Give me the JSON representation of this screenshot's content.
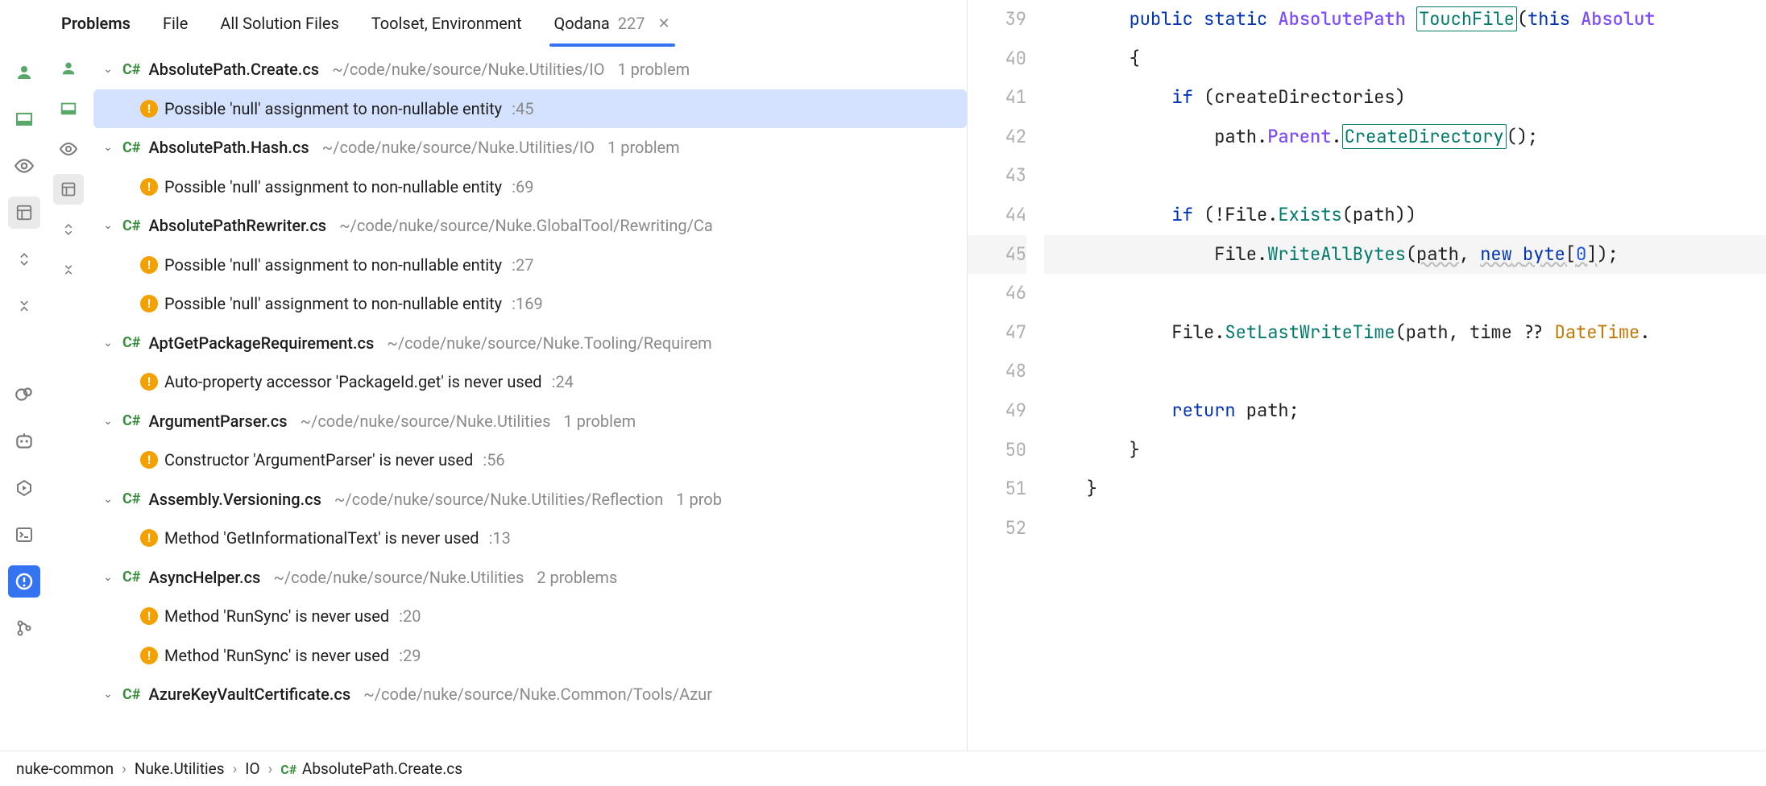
{
  "tabs": {
    "problems": "Problems",
    "file": "File",
    "allSolution": "All Solution Files",
    "toolset": "Toolset, Environment",
    "qodana": "Qodana",
    "qodana_count": "227"
  },
  "tree": [
    {
      "kind": "file",
      "name": "AbsolutePath.Create.cs",
      "path": "~/code/nuke/source/Nuke.Utilities/IO",
      "count": "1 problem",
      "selected": false
    },
    {
      "kind": "issue",
      "text": "Possible 'null' assignment to non-nullable entity",
      "loc": ":45",
      "selected": true
    },
    {
      "kind": "file",
      "name": "AbsolutePath.Hash.cs",
      "path": "~/code/nuke/source/Nuke.Utilities/IO",
      "count": "1 problem"
    },
    {
      "kind": "issue",
      "text": "Possible 'null' assignment to non-nullable entity",
      "loc": ":69"
    },
    {
      "kind": "file",
      "name": "AbsolutePathRewriter.cs",
      "path": "~/code/nuke/source/Nuke.GlobalTool/Rewriting/Ca",
      "count": ""
    },
    {
      "kind": "issue",
      "text": "Possible 'null' assignment to non-nullable entity",
      "loc": ":27"
    },
    {
      "kind": "issue",
      "text": "Possible 'null' assignment to non-nullable entity",
      "loc": ":169"
    },
    {
      "kind": "file",
      "name": "AptGetPackageRequirement.cs",
      "path": "~/code/nuke/source/Nuke.Tooling/Requirem",
      "count": ""
    },
    {
      "kind": "issue",
      "text": "Auto-property accessor 'PackageId.get' is never used",
      "loc": ":24"
    },
    {
      "kind": "file",
      "name": "ArgumentParser.cs",
      "path": "~/code/nuke/source/Nuke.Utilities",
      "count": "1 problem"
    },
    {
      "kind": "issue",
      "text": "Constructor 'ArgumentParser' is never used",
      "loc": ":56"
    },
    {
      "kind": "file",
      "name": "Assembly.Versioning.cs",
      "path": "~/code/nuke/source/Nuke.Utilities/Reflection",
      "count": "1 prob"
    },
    {
      "kind": "issue",
      "text": "Method 'GetInformationalText' is never used",
      "loc": ":13"
    },
    {
      "kind": "file",
      "name": "AsyncHelper.cs",
      "path": "~/code/nuke/source/Nuke.Utilities",
      "count": "2 problems"
    },
    {
      "kind": "issue",
      "text": "Method 'RunSync' is never used",
      "loc": ":20"
    },
    {
      "kind": "issue",
      "text": "Method 'RunSync' is never used",
      "loc": ":29"
    },
    {
      "kind": "file",
      "name": "AzureKeyVaultCertificate.cs",
      "path": "~/code/nuke/source/Nuke.Common/Tools/Azur",
      "count": ""
    }
  ],
  "editor": {
    "first_line": 39,
    "highlight_line": 45,
    "lines": [
      {
        "segs": [
          {
            "t": "        "
          },
          {
            "t": "public",
            "c": "tok-kw"
          },
          {
            "t": " "
          },
          {
            "t": "static",
            "c": "tok-kw"
          },
          {
            "t": " "
          },
          {
            "t": "AbsolutePath",
            "c": "tok-type"
          },
          {
            "t": " "
          },
          {
            "t": "TouchFile",
            "c": "tok-method tok-method-box"
          },
          {
            "t": "("
          },
          {
            "t": "this",
            "c": "tok-kw"
          },
          {
            "t": " "
          },
          {
            "t": "Absolut",
            "c": "tok-type"
          }
        ]
      },
      {
        "segs": [
          {
            "t": "        {"
          }
        ]
      },
      {
        "segs": [
          {
            "t": "            "
          },
          {
            "t": "if",
            "c": "tok-kw"
          },
          {
            "t": " (createDirectories)"
          }
        ]
      },
      {
        "segs": [
          {
            "t": "                path."
          },
          {
            "t": "Parent",
            "c": "tok-type"
          },
          {
            "t": "."
          },
          {
            "t": "CreateDirectory",
            "c": "tok-method tok-method-box"
          },
          {
            "t": "();"
          }
        ]
      },
      {
        "segs": [
          {
            "t": ""
          }
        ]
      },
      {
        "segs": [
          {
            "t": "            "
          },
          {
            "t": "if",
            "c": "tok-kw"
          },
          {
            "t": " (!File."
          },
          {
            "t": "Exists",
            "c": "tok-method"
          },
          {
            "t": "(path))"
          }
        ]
      },
      {
        "segs": [
          {
            "t": "                File."
          },
          {
            "t": "WriteAllBytes",
            "c": "tok-method"
          },
          {
            "t": "("
          },
          {
            "t": "path",
            "c": "tok-underline"
          },
          {
            "t": ", "
          },
          {
            "t": "new",
            "c": "tok-kw tok-underline"
          },
          {
            "t": " ",
            "c": "tok-underline"
          },
          {
            "t": "byte",
            "c": "tok-kw tok-underline"
          },
          {
            "t": "[",
            "c": "tok-underline"
          },
          {
            "t": "0",
            "c": "tok-num tok-underline"
          },
          {
            "t": "]",
            "c": "tok-underline"
          },
          {
            "t": ");"
          }
        ]
      },
      {
        "segs": [
          {
            "t": ""
          }
        ]
      },
      {
        "segs": [
          {
            "t": "            File."
          },
          {
            "t": "SetLastWriteTime",
            "c": "tok-method"
          },
          {
            "t": "(path, time ?? "
          },
          {
            "t": "DateTime",
            "c": "tok-warn"
          },
          {
            "t": "."
          }
        ]
      },
      {
        "segs": [
          {
            "t": ""
          }
        ]
      },
      {
        "segs": [
          {
            "t": "            "
          },
          {
            "t": "return",
            "c": "tok-kw"
          },
          {
            "t": " path;"
          }
        ]
      },
      {
        "segs": [
          {
            "t": "        }"
          }
        ]
      },
      {
        "segs": [
          {
            "t": "    }"
          }
        ]
      },
      {
        "segs": [
          {
            "t": ""
          }
        ]
      }
    ]
  },
  "breadcrumbs": {
    "items": [
      "nuke-common",
      "Nuke.Utilities",
      "IO"
    ],
    "current": {
      "lang": "C#",
      "file": "AbsolutePath.Create.cs"
    }
  }
}
